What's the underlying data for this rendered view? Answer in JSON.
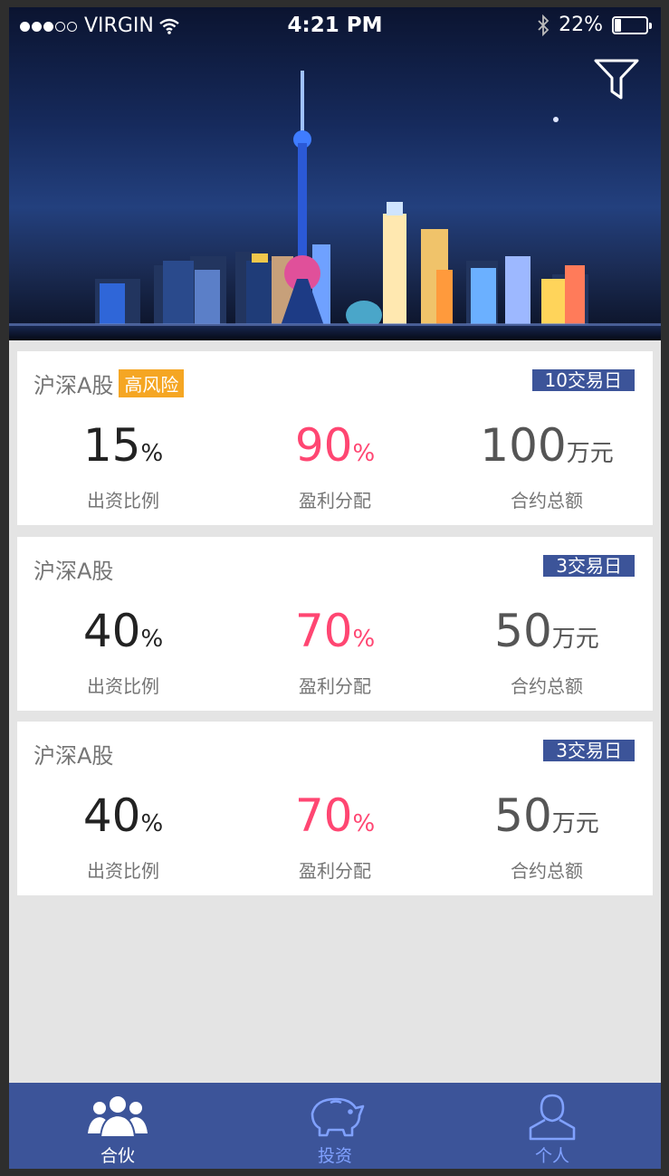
{
  "status_bar": {
    "carrier": "VIRGIN",
    "time": "4:21 PM",
    "battery": "22%",
    "battery_level": 0.22
  },
  "colors": {
    "background": "#e4e4e4",
    "card": "#ffffff",
    "primary_text": "#222222",
    "secondary_text": "#757575",
    "accent": "#ff4672",
    "brand": "#3c5499",
    "tab_inactive": "#80a1ff",
    "risk_badge": "#f5a623"
  },
  "cards": [
    {
      "market": "沪深A股",
      "risk_badge": "高风险",
      "days": "10交易日",
      "ratio": {
        "value": "15",
        "unit": "%",
        "label": "出资比例"
      },
      "profit": {
        "value": "90",
        "unit": "%",
        "label": "盈利分配"
      },
      "total": {
        "value": "100",
        "unit": "万元",
        "label": "合约总额"
      }
    },
    {
      "market": "沪深A股",
      "days": "3交易日",
      "ratio": {
        "value": "40",
        "unit": "%",
        "label": "出资比例"
      },
      "profit": {
        "value": "70",
        "unit": "%",
        "label": "盈利分配"
      },
      "total": {
        "value": "50",
        "unit": "万元",
        "label": "合约总额"
      }
    },
    {
      "market": "沪深A股",
      "days": "3交易日",
      "ratio": {
        "value": "40",
        "unit": "%",
        "label": "出资比例"
      },
      "profit": {
        "value": "70",
        "unit": "%",
        "label": "盈利分配"
      },
      "total": {
        "value": "50",
        "unit": "万元",
        "label": "合约总额"
      }
    }
  ],
  "tabbar": {
    "items": [
      {
        "label": "合伙",
        "icon": "group-icon",
        "active": true
      },
      {
        "label": "投资",
        "icon": "piggy-bank-icon",
        "active": false
      },
      {
        "label": "个人",
        "icon": "person-icon",
        "active": false
      }
    ]
  }
}
